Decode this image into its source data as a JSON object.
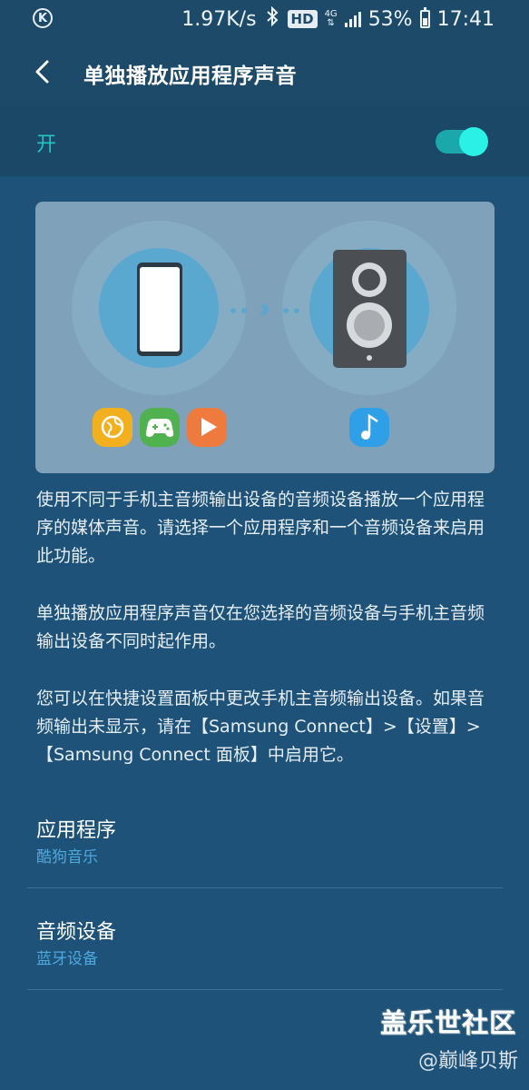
{
  "status_bar": {
    "left_icon": "k-circle-icon",
    "speed": "1.97K/s",
    "bluetooth_icon": "bluetooth-icon",
    "hd_badge": "HD",
    "network_type": "4G",
    "battery_percent": "53%",
    "time": "17:41"
  },
  "header": {
    "title": "单独播放应用程序声音"
  },
  "master_switch": {
    "label": "开",
    "enabled": true,
    "accent_color": "#2af0e6"
  },
  "illustration": {
    "left_device_icon": "smartphone-icon",
    "link_icon": "bluetooth-link-icon",
    "right_device_icon": "speaker-icon",
    "app_icons": [
      {
        "name": "globe-app-icon",
        "color": "#f2b01e"
      },
      {
        "name": "gamepad-app-icon",
        "color": "#4fb24f"
      },
      {
        "name": "play-app-icon",
        "color": "#ee7a3e"
      }
    ],
    "audio_app_icon": {
      "name": "music-note-icon",
      "color": "#2f9fe8"
    }
  },
  "description": [
    "使用不同于手机主音频输出设备的音频设备播放一个应用程序的媒体声音。请选择一个应用程序和一个音频设备来启用此功能。",
    "单独播放应用程序声音仅在您选择的音频设备与手机主音频输出设备不同时起作用。",
    "您可以在快捷设置面板中更改手机主音频输出设备。如果音频输出未显示，请在【Samsung Connect】>【设置】>【Samsung Connect 面板】中启用它。"
  ],
  "settings": {
    "app": {
      "title": "应用程序",
      "value": "酷狗音乐"
    },
    "audio_device": {
      "title": "音频设备",
      "value": "蓝牙设备"
    }
  },
  "watermark": {
    "line1": "盖乐世社区",
    "line2": "@巅峰贝斯"
  }
}
